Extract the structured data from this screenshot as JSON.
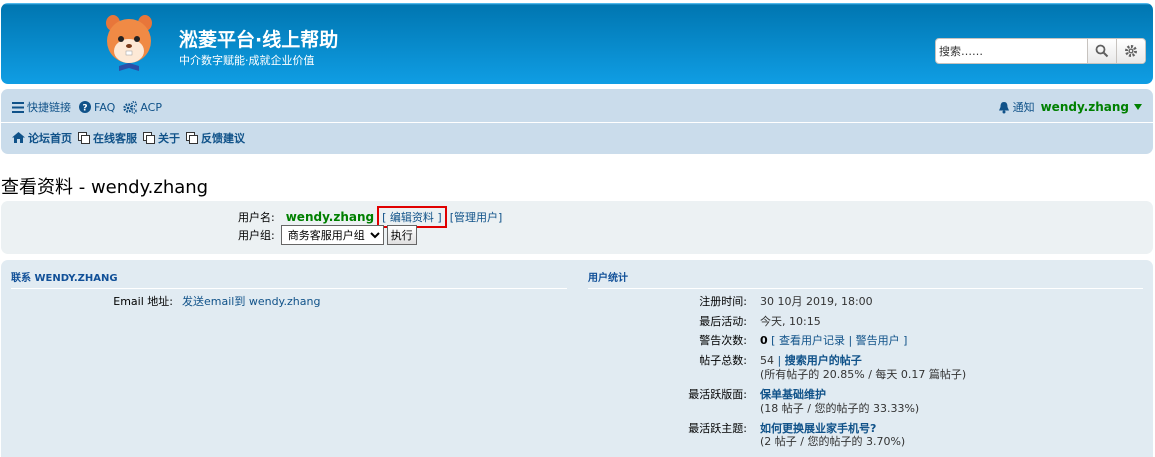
{
  "header": {
    "site_title": "淞菱平台·线上帮助",
    "site_description": "中介数字赋能·成就企业价值",
    "logo_icon": "hamster-mascot-icon",
    "search_placeholder": "搜索……",
    "colors": {
      "header_bg": "#12a3eb",
      "nav_bg": "#cadceb",
      "link": "#105289",
      "username": "#008000",
      "highlight": "#e00000"
    }
  },
  "nav": {
    "quick_links": "快捷链接",
    "faq": "FAQ",
    "acp": "ACP",
    "notifications": "通知",
    "username": "wendy.zhang",
    "home": "论坛首页",
    "online_service": "在线客服",
    "about": "关于",
    "feedback": "反馈建议"
  },
  "page": {
    "title": "查看资料 - wendy.zhang"
  },
  "profile": {
    "username_label": "用户名:",
    "username": "wendy.zhang",
    "edit_profile": "编辑资料",
    "manage_user": "管理用户",
    "group_label": "用户组:",
    "group_selected": "商务客服用户组",
    "execute_button": "执行"
  },
  "contact": {
    "heading": "联系 WENDY.ZHANG",
    "email_label": "Email 地址:",
    "email_link": "发送email到 wendy.zhang"
  },
  "stats": {
    "heading": "用户统计",
    "registered_label": "注册时间:",
    "registered_value": "30 10月 2019, 18:00",
    "last_active_label": "最后活动:",
    "last_active_value": "今天, 10:15",
    "warnings_label": "警告次数:",
    "warnings_count": "0",
    "view_user_notes": "查看用户记录",
    "warn_user": "警告用户",
    "posts_label": "帖子总数:",
    "posts_count": "54",
    "search_user_posts": "搜索用户的帖子",
    "posts_percent": "(所有帖子的 20.85% / 每天 0.17 篇帖子)",
    "active_forum_label": "最活跃版面:",
    "active_forum": "保单基础维护",
    "active_forum_stats": "(18 帖子 / 您的帖子的 33.33%)",
    "active_topic_label": "最活跃主题:",
    "active_topic": "如何更换展业家手机号?",
    "active_topic_stats": "(2 帖子 / 您的帖子的 3.70%)"
  }
}
